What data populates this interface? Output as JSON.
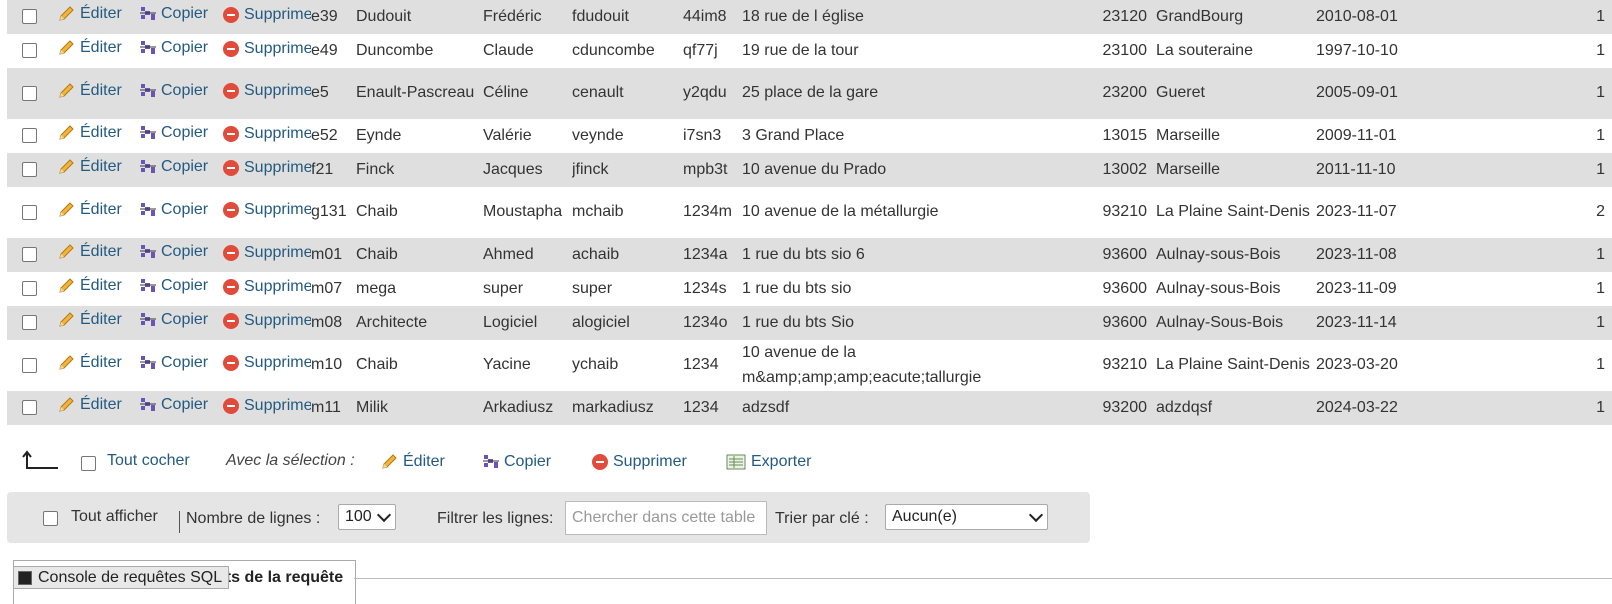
{
  "actions": {
    "edit": "Éditer",
    "copy": "Copier",
    "delete": "Supprimer"
  },
  "rows": [
    [
      "e39",
      "Dudouit",
      "Frédéric",
      "fdudouit",
      "44im8",
      "18 rue de l église",
      "23120",
      "GrandBourg",
      "2010-08-01",
      "1"
    ],
    [
      "e49",
      "Duncombe",
      "Claude",
      "cduncombe",
      "qf77j",
      "19 rue de la tour",
      "23100",
      "La souteraine",
      "1997-10-10",
      "1"
    ],
    [
      "e5",
      "Enault-Pascreau",
      "Céline",
      "cenault",
      "y2qdu",
      "25 place de la gare",
      "23200",
      "Gueret",
      "2005-09-01",
      "1"
    ],
    [
      "e52",
      "Eynde",
      "Valérie",
      "veynde",
      "i7sn3",
      "3 Grand Place",
      "13015",
      "Marseille",
      "2009-11-01",
      "1"
    ],
    [
      "f21",
      "Finck",
      "Jacques",
      "jfinck",
      "mpb3t",
      "10 avenue du Prado",
      "13002",
      "Marseille",
      "2011-11-10",
      "1"
    ],
    [
      "g131",
      "Chaib",
      "Moustapha",
      "mchaib",
      "1234m",
      "10 avenue de la métallurgie",
      "93210",
      "La Plaine Saint-Denis",
      "2023-11-07",
      "2"
    ],
    [
      "m01",
      "Chaib",
      "Ahmed",
      "achaib",
      "1234a",
      "1 rue du bts sio 6",
      "93600",
      "Aulnay-sous-Bois",
      "2023-11-08",
      "1"
    ],
    [
      "m07",
      "mega",
      "super",
      "super",
      "1234s",
      "1 rue du bts sio",
      "93600",
      "Aulnay-sous-Bois",
      "2023-11-09",
      "1"
    ],
    [
      "m08",
      "Architecte",
      "Logiciel",
      "alogiciel",
      "1234o",
      "1 rue du bts Sio",
      "93600",
      "Aulnay-Sous-Bois",
      "2023-11-14",
      "1"
    ],
    [
      "m10",
      "Chaib",
      "Yacine",
      "ychaib",
      "1234",
      "10 avenue de la m&amp;amp;amp;eacute;tallurgie",
      "93210",
      "La Plaine Saint-Denis",
      "2023-03-20",
      "1"
    ],
    [
      "m11",
      "Milik",
      "Arkadiusz",
      "markadiusz",
      "1234",
      "adzsdf",
      "93200",
      "adzdqsf",
      "2024-03-22",
      "1"
    ]
  ],
  "selection": {
    "check_all": "Tout cocher",
    "with_selection": "Avec la sélection :",
    "edit": "Éditer",
    "copy": "Copier",
    "delete": "Supprimer",
    "export": "Exporter"
  },
  "navigation": {
    "show_all": "Tout afficher",
    "rows_label": "Nombre de lignes :",
    "rows_value": "100",
    "filter_label": "Filtrer les lignes:",
    "filter_placeholder": "Chercher dans cette table",
    "sort_label": "Trier par clé :",
    "sort_value": "Aucun(e)"
  },
  "console": {
    "tab_label": "Console de requêtes SQL",
    "panel_title": "nts de la requête"
  }
}
